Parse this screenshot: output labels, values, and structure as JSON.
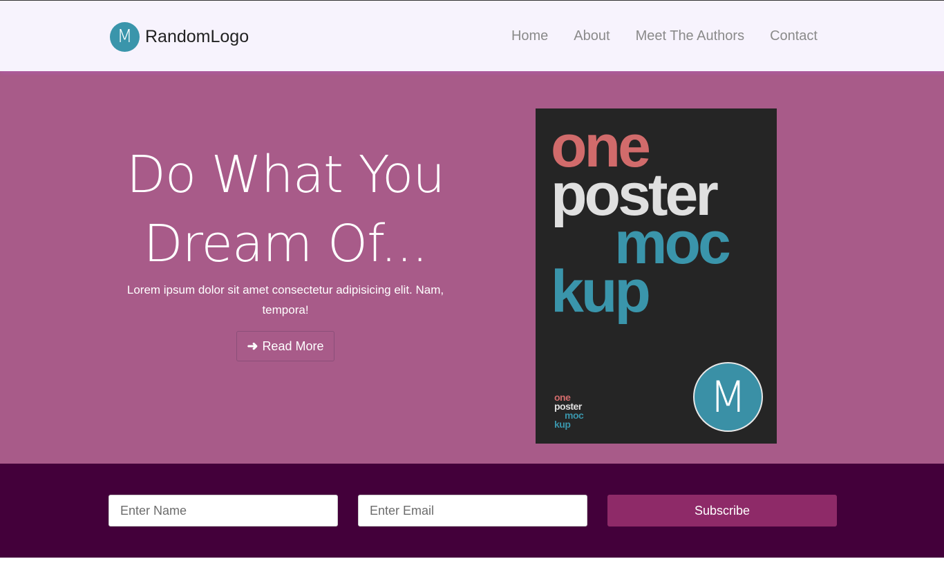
{
  "navbar": {
    "brand_icon_letter": "M",
    "brand_name": "RandomLogo",
    "links": [
      "Home",
      "About",
      "Meet The Authors",
      "Contact"
    ]
  },
  "hero": {
    "title_line1": "Do What You",
    "title_line2": "Dream Of...",
    "subtitle": "Lorem ipsum dolor sit amet consectetur adipisicing elit. Nam, tempora!",
    "read_more_label": "Read More",
    "read_more_icon": "arrow-right-icon"
  },
  "poster": {
    "word1": "one",
    "word2": "poster",
    "word3": "moc",
    "word4": "kup",
    "badge_letter": "M",
    "colors": {
      "background": "#252525",
      "red": "#d16b6b",
      "white": "#e0e0e0",
      "teal": "#3a95ab"
    }
  },
  "subscribe": {
    "name_placeholder": "Enter Name",
    "email_placeholder": "Enter Email",
    "button_label": "Subscribe"
  },
  "colors": {
    "navbar_bg": "#f7f3fd",
    "hero_bg": "#a85b89",
    "subscribe_bg": "#43003a",
    "subscribe_button": "#8e2a68",
    "brand_teal": "#3a95ab"
  }
}
